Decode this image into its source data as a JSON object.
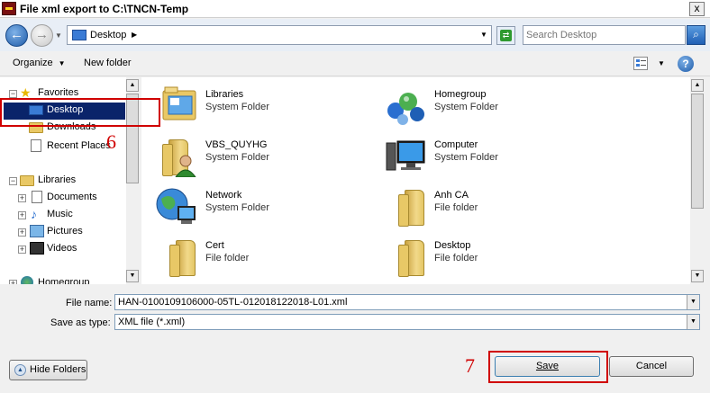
{
  "window": {
    "title": "File xml export to C:\\TNCN-Temp",
    "close_glyph": "x"
  },
  "address": {
    "location": "Desktop",
    "search_placeholder": "Search Desktop"
  },
  "toolbar": {
    "organize_label": "Organize",
    "new_folder_label": "New folder",
    "help_label": "?"
  },
  "nav": {
    "favorites_label": "Favorites",
    "desktop_label": "Desktop",
    "downloads_label": "Downloads",
    "recent_places_label": "Recent Places",
    "libraries_label": "Libraries",
    "documents_label": "Documents",
    "music_label": "Music",
    "pictures_label": "Pictures",
    "videos_label": "Videos",
    "homegroup_label": "Homegroup"
  },
  "files": [
    {
      "name": "Libraries",
      "type": "System Folder",
      "icon": "libraries-icon"
    },
    {
      "name": "Homegroup",
      "type": "System Folder",
      "icon": "homegroup-icon"
    },
    {
      "name": "VBS_QUYHG",
      "type": "System Folder",
      "icon": "user-folder-icon"
    },
    {
      "name": "Computer",
      "type": "System Folder",
      "icon": "computer-icon"
    },
    {
      "name": "Network",
      "type": "System Folder",
      "icon": "network-icon"
    },
    {
      "name": "Anh CA",
      "type": "File folder",
      "icon": "folder-icon"
    },
    {
      "name": "Cert",
      "type": "File folder",
      "icon": "folder-icon"
    },
    {
      "name": "Desktop",
      "type": "File folder",
      "icon": "folder-icon"
    }
  ],
  "form": {
    "file_name_label": "File name:",
    "file_name_value": "HAN-0100109106000-05TL-012018122018-L01.xml",
    "save_as_label": "Save as type:",
    "save_as_value": "XML file (*.xml)"
  },
  "buttons": {
    "hide_folders_label": "Hide Folders",
    "save_label": "Save",
    "cancel_label": "Cancel"
  },
  "annotations": {
    "step_desktop": "6",
    "step_save": "7"
  },
  "colors": {
    "annotation_red": "#d00000",
    "selection_blue": "#0a246a"
  }
}
